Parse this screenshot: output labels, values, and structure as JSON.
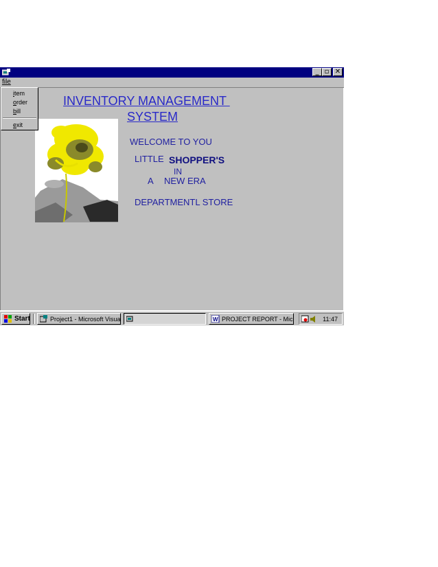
{
  "menu": {
    "file": "file"
  },
  "dropdown": {
    "items": [
      "item",
      "order",
      "bill",
      "exit"
    ]
  },
  "main": {
    "title_line1": "INVENTORY MANAGEMENT ",
    "title_line2": "SYSTEM",
    "welcome": "WELCOME TO YOU",
    "little": "LITTLE",
    "shoppers": "SHOPPER'S",
    "in": "IN",
    "a": "A",
    "new_era": "NEW ERA",
    "store": "DEPARTMENTL STORE"
  },
  "taskbar": {
    "start": "Start",
    "task1": "Project1 - Microsoft Visual...",
    "task2": "",
    "task3": "PROJECT REPORT - Mic...",
    "clock": "11:47"
  },
  "colors": {
    "titlebar": "#000080",
    "face": "#c0c0c0",
    "title_text": "#2929c8"
  }
}
